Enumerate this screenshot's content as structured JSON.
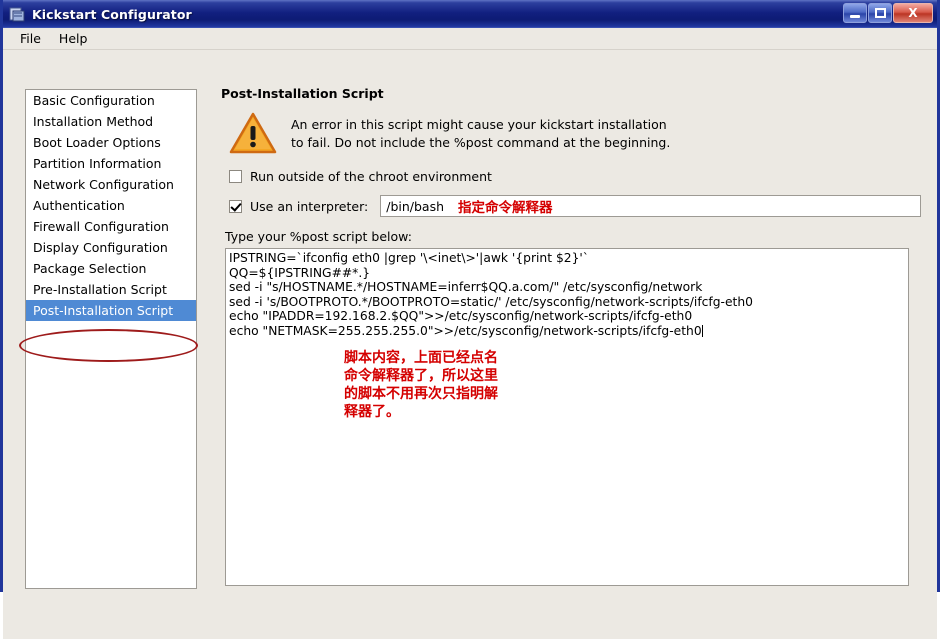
{
  "window": {
    "title": "Kickstart Configurator",
    "icon": "app-icon",
    "buttons": {
      "minimize": "minimize-icon",
      "maximize": "maximize-icon",
      "close": "X"
    }
  },
  "menubar": {
    "items": [
      {
        "label": "File"
      },
      {
        "label": "Help"
      }
    ]
  },
  "sidebar": {
    "items": [
      {
        "label": "Basic Configuration",
        "selected": false
      },
      {
        "label": "Installation Method",
        "selected": false
      },
      {
        "label": "Boot Loader Options",
        "selected": false
      },
      {
        "label": "Partition Information",
        "selected": false
      },
      {
        "label": "Network Configuration",
        "selected": false
      },
      {
        "label": "Authentication",
        "selected": false
      },
      {
        "label": "Firewall Configuration",
        "selected": false
      },
      {
        "label": "Display Configuration",
        "selected": false
      },
      {
        "label": "Package Selection",
        "selected": false
      },
      {
        "label": "Pre-Installation Script",
        "selected": false
      },
      {
        "label": "Post-Installation Script",
        "selected": true
      }
    ]
  },
  "panel": {
    "title": "Post-Installation Script",
    "warning": {
      "icon": "warning-triangle-icon",
      "line1": "An error in this script might cause your kickstart installation",
      "line2": "to fail. Do not include the %post command at the beginning."
    },
    "chroot_checkbox": {
      "label": "Run outside of the chroot environment",
      "checked": false
    },
    "interpreter_checkbox": {
      "label": "Use an interpreter:",
      "checked": true
    },
    "interpreter_field": {
      "value": "/bin/bash",
      "placeholder": "",
      "annotation": "指定命令解释器"
    },
    "script_label": "Type your %post script below:",
    "script_lines": [
      "IPSTRING=`ifconfig eth0 |grep '\\<inet\\>'|awk '{print $2}'`",
      "QQ=${IPSTRING##*.}",
      "sed -i \"s/HOSTNAME.*/HOSTNAME=inferr$QQ.a.com/\" /etc/sysconfig/network",
      "sed -i 's/BOOTPROTO.*/BOOTPROTO=static/' /etc/sysconfig/network-scripts/ifcfg-eth0",
      "echo \"IPADDR=192.168.2.$QQ\">>/etc/sysconfig/network-scripts/ifcfg-eth0",
      "echo \"NETMASK=255.255.255.0\">>/etc/sysconfig/network-scripts/ifcfg-eth0"
    ],
    "note_lines": [
      "脚本内容，上面已经点名",
      "命令解释器了，所以这里",
      "的脚本不用再次只指明解",
      "释器了。"
    ]
  },
  "colors": {
    "titlebar_blue": "#122080",
    "selection_blue": "#4f8ad4",
    "annotation_red": "#d40000",
    "oval_red": "#9e1b1b",
    "warning_orange": "#f08a1e",
    "panel_bg": "#ece9e3"
  }
}
